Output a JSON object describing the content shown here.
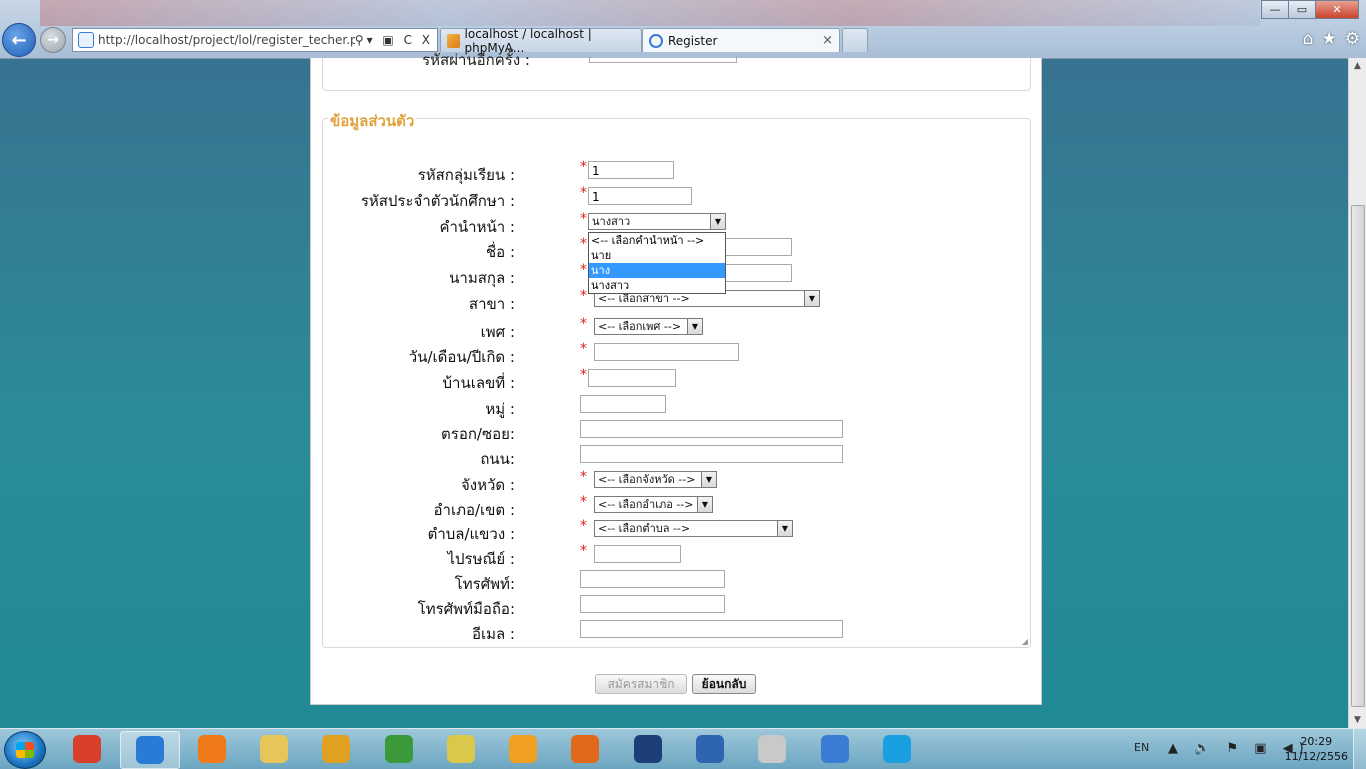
{
  "browser": {
    "url": "http://localhost/project/lol/register_techer.php",
    "tabs": [
      {
        "label": "localhost / localhost | phpMyA..."
      },
      {
        "label": "Register"
      }
    ],
    "nav_back": "←",
    "nav_forward": "→",
    "address_tools": "⚲▾ ▣ C X",
    "tab_close": "×",
    "win_minimize": "—",
    "win_maximize": "▭",
    "win_close": "✕",
    "right_icons": {
      "home": "⌂",
      "favorites": "★",
      "settings": "⚙"
    }
  },
  "page": {
    "top_section_cut_label": "รหัสผ่านอีกครั้ง :",
    "section_title": "ข้อมูลส่วนตัว",
    "required_mark": "*",
    "fields": {
      "class_group": {
        "label": "รหัสกลุ่มเรียน :",
        "value": "1"
      },
      "student_id": {
        "label": "รหัสประจำตัวนักศึกษา :",
        "value": "1"
      },
      "prefix": {
        "label": "คำนำหน้า :",
        "selected": "นางสาว",
        "options": [
          "<-- เลือกคำนำหน้า -->",
          "นาย",
          "นาง",
          "นางสาว"
        ],
        "highlighted_index": 2
      },
      "first_name": {
        "label": "ชื่อ :"
      },
      "last_name": {
        "label": "นามสกุล :"
      },
      "branch": {
        "label": "สาขา :",
        "selected": "<-- เลือกสาขา -->"
      },
      "gender": {
        "label": "เพศ :",
        "selected": "<-- เลือกเพศ -->"
      },
      "birthdate": {
        "label": "วัน/เดือน/ปีเกิด :"
      },
      "house_no": {
        "label": "บ้านเลขที่ :"
      },
      "moo": {
        "label": "หมู่ :"
      },
      "soi": {
        "label": "ตรอก/ซอย:"
      },
      "road": {
        "label": "ถนน:"
      },
      "province": {
        "label": "จังหวัด :",
        "selected": "<-- เลือกจังหวัด -->"
      },
      "district": {
        "label": "อำเภอ/เขต :",
        "selected": "<-- เลือกอำเภอ -->"
      },
      "subdistrict": {
        "label": "ตำบล/แขวง :",
        "selected": "<-- เลือกตำบล -->"
      },
      "postal": {
        "label": "ไปรษณีย์ :"
      },
      "phone": {
        "label": "โทรศัพท์:"
      },
      "mobile": {
        "label": "โทรศัพท์มือถือ:"
      },
      "email": {
        "label": "อีเมล :"
      }
    },
    "buttons": {
      "register": "สมัครสมาชิก",
      "back": "ย้อนกลับ"
    }
  },
  "taskbar": {
    "lang": "EN",
    "time": "20:29",
    "date": "11/12/2556",
    "tray_icons": "▲ 🔈 ⚑ ▣ ◀)",
    "apps": [
      {
        "name": "app-1",
        "color": "#d8402a"
      },
      {
        "name": "internet-explorer",
        "color": "#2a7bd6"
      },
      {
        "name": "media-player",
        "color": "#f07a1a"
      },
      {
        "name": "file-explorer",
        "color": "#e6c55a"
      },
      {
        "name": "chrome",
        "color": "#e0a020"
      },
      {
        "name": "app-globe",
        "color": "#3a9a3a"
      },
      {
        "name": "sticky-notes",
        "color": "#d9c84a"
      },
      {
        "name": "app-orange",
        "color": "#f0a020"
      },
      {
        "name": "firefox",
        "color": "#e06a1a"
      },
      {
        "name": "photoshop",
        "color": "#1c3f7a"
      },
      {
        "name": "app-blue",
        "color": "#2f64b0"
      },
      {
        "name": "app-window",
        "color": "#c9c9c9"
      },
      {
        "name": "app-bolt",
        "color": "#3a7bd6"
      },
      {
        "name": "skype",
        "color": "#1aa0e0"
      }
    ]
  },
  "colors": {
    "legend": "#e0a23a",
    "required": "#e02020",
    "highlight": "#3399ff"
  }
}
